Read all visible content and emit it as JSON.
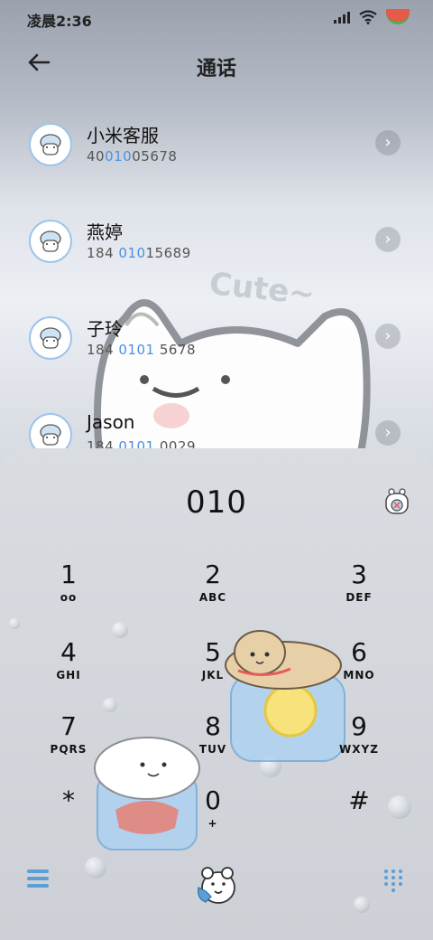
{
  "status_bar": {
    "time": "凌晨2:36",
    "icons": [
      "signal-icon",
      "wifi-icon",
      "battery-icon"
    ]
  },
  "header": {
    "title": "通话",
    "back_icon": "arrow-left-icon"
  },
  "contacts": [
    {
      "name": "小米客服",
      "number_pre": "40",
      "number_hl": "010",
      "number_post": "05678"
    },
    {
      "name": "燕婷",
      "number_pre": "184 ",
      "number_hl": "010",
      "number_post": "15689"
    },
    {
      "name": "子玲",
      "number_pre": "184 ",
      "number_hl": "0101",
      "number_post": " 5678"
    },
    {
      "name": "Jason",
      "number_pre": "184 ",
      "number_hl": "0101",
      "number_post": " 0029"
    }
  ],
  "decoration": {
    "cute_text": "Cute~"
  },
  "dialpad": {
    "digits": "010",
    "keys": [
      {
        "num": "1",
        "letters": "oo"
      },
      {
        "num": "2",
        "letters": "ABC"
      },
      {
        "num": "3",
        "letters": "DEF"
      },
      {
        "num": "4",
        "letters": "GHI"
      },
      {
        "num": "5",
        "letters": "JKL"
      },
      {
        "num": "6",
        "letters": "MNO"
      },
      {
        "num": "7",
        "letters": "PQRS"
      },
      {
        "num": "8",
        "letters": "TUV"
      },
      {
        "num": "9",
        "letters": "WXYZ"
      },
      {
        "num": "*",
        "letters": ""
      },
      {
        "num": "0",
        "letters": "+"
      },
      {
        "num": "#",
        "letters": ""
      }
    ]
  },
  "bottom_bar": {
    "left_icon": "menu-icon",
    "center_icon": "call-icon",
    "right_icon": "keypad-icon"
  },
  "colors": {
    "accent": "#5a9fd8",
    "highlight": "#4a90e2"
  }
}
